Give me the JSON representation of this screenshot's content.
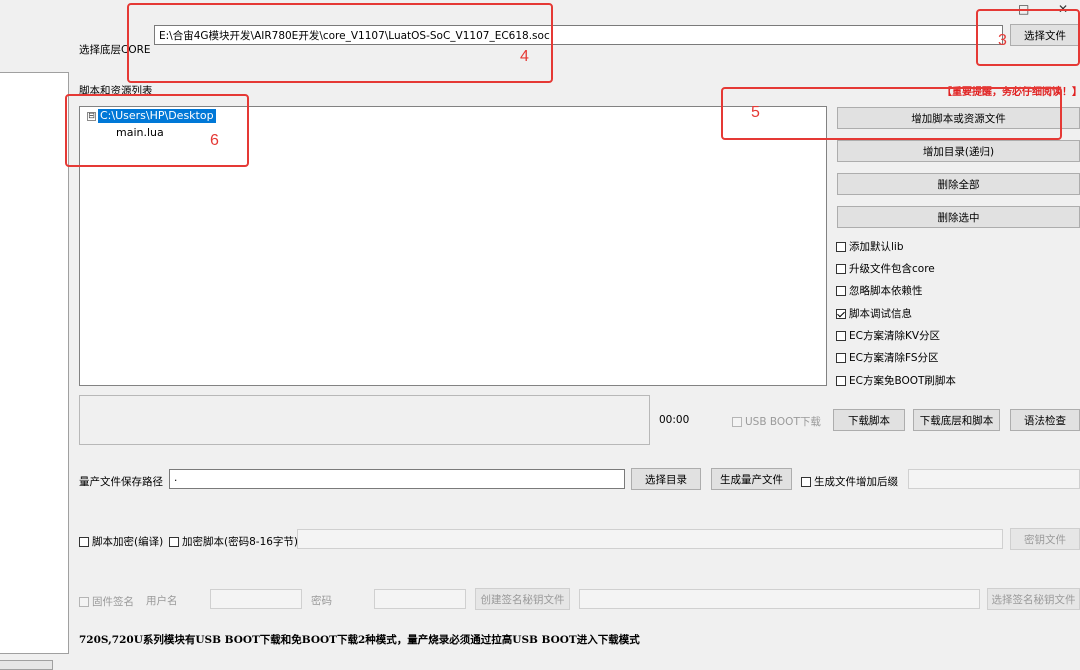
{
  "window_controls": {
    "restore": "□",
    "close": "✕"
  },
  "core": {
    "label": "选择底层CORE",
    "path": "E:\\合宙4G模块开发\\AIR780E开发\\core_V1107\\LuatOS-SoC_V1107_EC618.soc",
    "select_file_button": "选择文件"
  },
  "scripts": {
    "label": "脚本和资源列表",
    "tree_root": "C:\\Users\\HP\\Desktop",
    "tree_toggle": "⊟",
    "tree_children": [
      "main.lua"
    ]
  },
  "warning": "【重要提醒，务必仔细阅读！】",
  "side_buttons": {
    "add_script": "增加脚本或资源文件",
    "add_dir": "增加目录(递归)",
    "delete_all": "删除全部",
    "delete_selected": "删除选中"
  },
  "options": [
    {
      "label": "添加默认lib",
      "checked": false
    },
    {
      "label": "升级文件包含core",
      "checked": false
    },
    {
      "label": "忽略脚本依赖性",
      "checked": false
    },
    {
      "label": "脚本调试信息",
      "checked": true
    },
    {
      "label": "EC方案清除KV分区",
      "checked": false
    },
    {
      "label": "EC方案清除FS分区",
      "checked": false
    },
    {
      "label": "EC方案免BOOT刷脚本",
      "checked": false
    }
  ],
  "download": {
    "time": "00:00",
    "usb_boot": "USB BOOT下载",
    "download_script": "下载脚本",
    "download_core_script": "下载底层和脚本",
    "syntax_check": "语法检查"
  },
  "production": {
    "label": "量产文件保存路径",
    "path": ".",
    "select_dir": "选择目录",
    "generate": "生成量产文件",
    "suffix_label": "生成文件增加后缀"
  },
  "encrypt": {
    "script_encrypt": "脚本加密(编译)",
    "encrypt_script": "加密脚本(密码8-16字节)",
    "key_file": "密钥文件"
  },
  "signature": {
    "firmware_sign": "固件签名",
    "username": "用户名",
    "password": "密码",
    "create_key": "创建签名秘钥文件",
    "select_key": "选择签名秘钥文件"
  },
  "footer_note": "720S,720U系列模块有USB BOOT下载和免BOOT下载2种模式，量产烧录必须通过拉高USB BOOT进入下载模式",
  "annotations": [
    "3",
    "4",
    "5",
    "6"
  ],
  "colors": {
    "annotation": "#e53935",
    "selection": "#0078d7",
    "warning": "#e02020"
  }
}
